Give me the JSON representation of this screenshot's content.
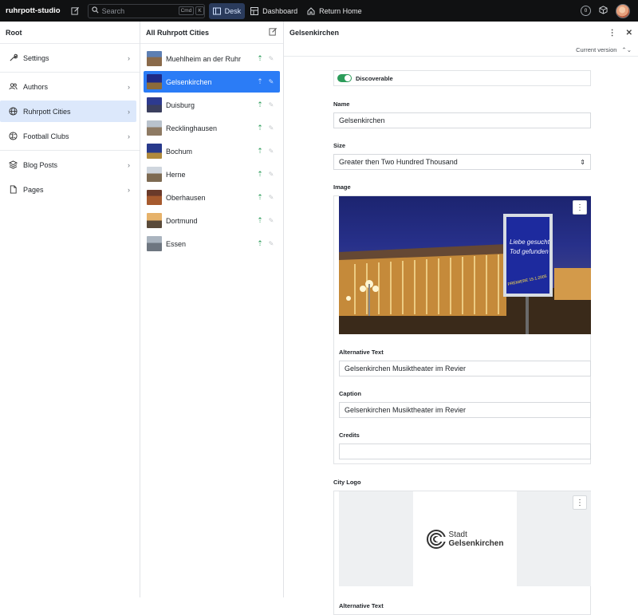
{
  "topbar": {
    "brand": "ruhrpott-studio",
    "search_placeholder": "Search",
    "shortcut_keys": [
      "Cmd",
      "K"
    ],
    "nav": [
      {
        "label": "Desk",
        "icon": "desk-icon",
        "active": true
      },
      {
        "label": "Dashboard",
        "icon": "dashboard-icon",
        "active": false
      },
      {
        "label": "Return Home",
        "icon": "home-icon",
        "active": false
      }
    ],
    "notification_count": "0"
  },
  "root_pane": {
    "title": "Root",
    "items": [
      {
        "label": "Settings",
        "icon": "wrench-icon"
      },
      {
        "label": "Authors",
        "icon": "users-icon"
      },
      {
        "label": "Ruhrpott Cities",
        "icon": "globe-icon",
        "active": true
      },
      {
        "label": "Football Clubs",
        "icon": "ball-icon"
      },
      {
        "label": "Blog Posts",
        "icon": "stack-icon"
      },
      {
        "label": "Pages",
        "icon": "document-icon"
      }
    ]
  },
  "list_pane": {
    "title": "All Ruhrpott Cities",
    "items": [
      {
        "name": "Muehlheim an der Ruhr"
      },
      {
        "name": "Gelsenkirchen",
        "active": true
      },
      {
        "name": "Duisburg"
      },
      {
        "name": "Recklinghausen"
      },
      {
        "name": "Bochum"
      },
      {
        "name": "Herne"
      },
      {
        "name": "Oberhausen"
      },
      {
        "name": "Dortmund"
      },
      {
        "name": "Essen"
      }
    ]
  },
  "detail": {
    "title": "Gelsenkirchen",
    "version_label": "Current version",
    "discoverable_label": "Discoverable",
    "discoverable": true,
    "name_label": "Name",
    "name_value": "Gelsenkirchen",
    "size_label": "Size",
    "size_value": "Greater then Two Hundred Thousand",
    "image_label": "Image",
    "image_alt_label": "Alternative Text",
    "image_alt_value": "Gelsenkirchen Musiktheater im Revier",
    "caption_label": "Caption",
    "caption_value": "Gelsenkirchen Musiktheater im Revier",
    "credits_label": "Credits",
    "credits_value": "",
    "logo_label": "City Logo",
    "logo_text_line1": "Stadt",
    "logo_text_line2": "Gelsenkirchen",
    "logo_alt_label": "Alternative Text",
    "poster_text": [
      "Liebe gesucht",
      "Tod gefunden",
      "PREMIERE 15.1.2005"
    ]
  }
}
